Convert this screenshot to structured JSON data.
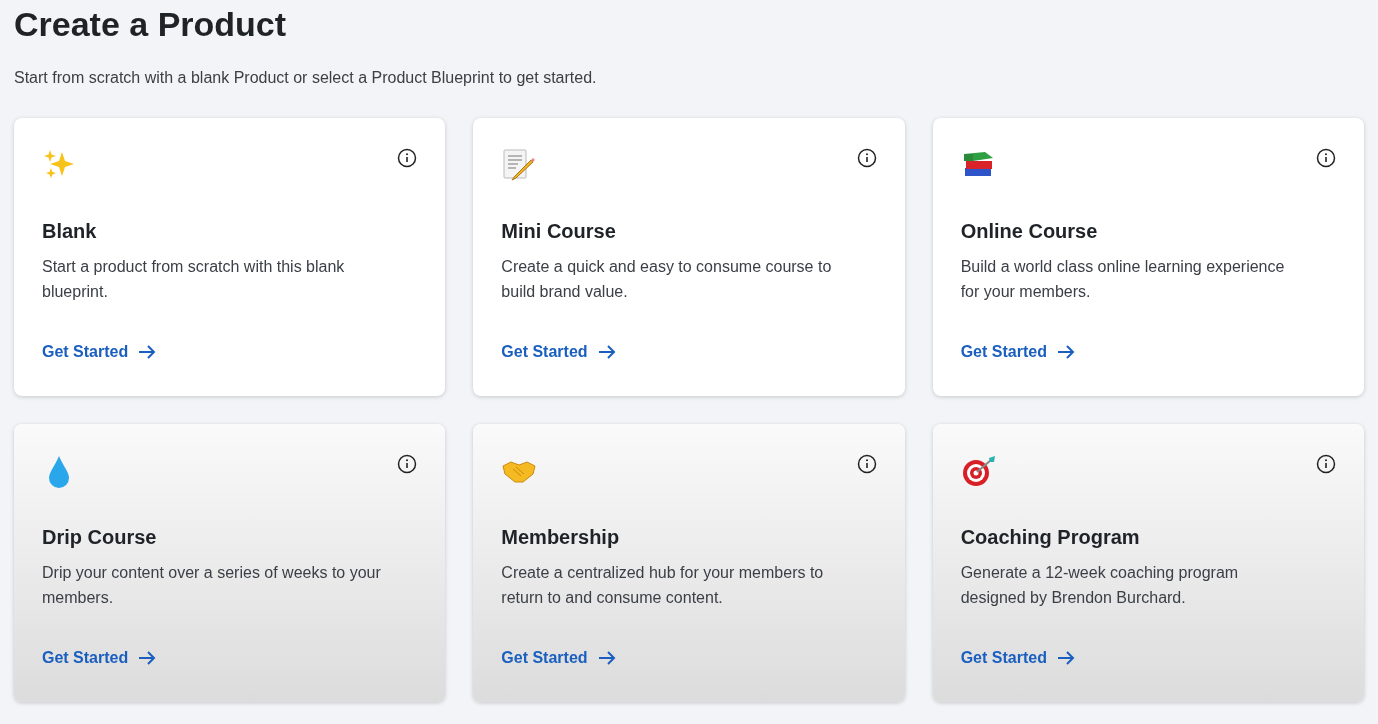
{
  "title": "Create a Product",
  "subtitle": "Start from scratch with a blank Product or select a Product Blueprint to get started.",
  "cards": [
    {
      "title": "Blank",
      "description": "Start a product from scratch with this blank blueprint.",
      "link": "Get Started"
    },
    {
      "title": "Mini Course",
      "description": "Create a quick and easy to consume course to build brand value.",
      "link": "Get Started"
    },
    {
      "title": "Online Course",
      "description": "Build a world class online learning experience for your members.",
      "link": "Get Started"
    },
    {
      "title": "Drip Course",
      "description": "Drip your content over a series of weeks to your members.",
      "link": "Get Started"
    },
    {
      "title": "Membership",
      "description": "Create a centralized hub for your members to return to and consume content.",
      "link": "Get Started"
    },
    {
      "title": "Coaching Program",
      "description": "Generate a 12-week coaching program designed by Brendon Burchard.",
      "link": "Get Started"
    }
  ]
}
